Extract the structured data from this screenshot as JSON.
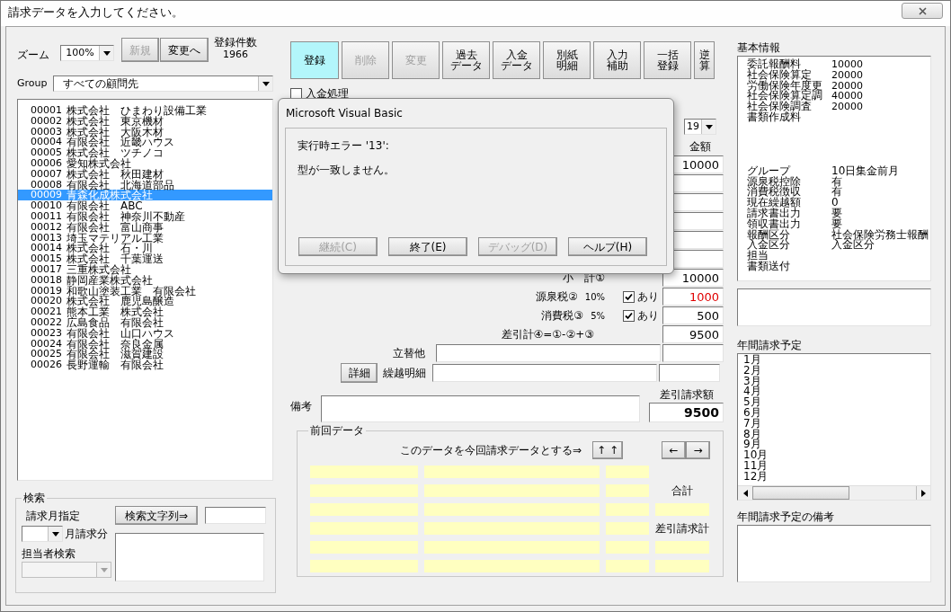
{
  "window": {
    "title": "請求データを入力してください。"
  },
  "zoom": {
    "label": "ズーム",
    "value": "100%"
  },
  "top_buttons": [
    {
      "label": "新規",
      "disabled": true
    },
    {
      "label": "変更へ",
      "disabled": false
    }
  ],
  "record_count": {
    "label": "登録件数",
    "value": "1966"
  },
  "group": {
    "label": "Group",
    "value": "すべての顧問先"
  },
  "clients": [
    {
      "code": "00001",
      "name": "株式会社　ひまわり設備工業",
      "selected": false
    },
    {
      "code": "00002",
      "name": "株式会社　東京機材",
      "selected": false
    },
    {
      "code": "00003",
      "name": "株式会社　大阪木材",
      "selected": false
    },
    {
      "code": "00004",
      "name": "有限会社　近畿ハウス",
      "selected": false
    },
    {
      "code": "00005",
      "name": "株式会社　ツチノコ",
      "selected": false
    },
    {
      "code": "00006",
      "name": "愛知株式会社",
      "selected": false
    },
    {
      "code": "00007",
      "name": "株式会社　秋田建材",
      "selected": false
    },
    {
      "code": "00008",
      "name": "有限会社　北海道部品",
      "selected": false
    },
    {
      "code": "00009",
      "name": "青森化成株式会社",
      "selected": true
    },
    {
      "code": "00010",
      "name": "有限会社　ABC",
      "selected": false
    },
    {
      "code": "00011",
      "name": "有限会社　神奈川不動産",
      "selected": false
    },
    {
      "code": "00012",
      "name": "有限会社　富山商事",
      "selected": false
    },
    {
      "code": "00013",
      "name": "埼玉マテリアル工業",
      "selected": false
    },
    {
      "code": "00014",
      "name": "株式会社　石・川",
      "selected": false
    },
    {
      "code": "00015",
      "name": "株式会社　千葉運送",
      "selected": false
    },
    {
      "code": "00017",
      "name": "三重株式会社",
      "selected": false
    },
    {
      "code": "00018",
      "name": "静岡産業株式会社",
      "selected": false
    },
    {
      "code": "00019",
      "name": "和歌山塗装工業　有限会社",
      "selected": false
    },
    {
      "code": "00020",
      "name": "株式会社　鹿児島醸造",
      "selected": false
    },
    {
      "code": "00021",
      "name": "熊本工業　株式会社",
      "selected": false
    },
    {
      "code": "00022",
      "name": "広島食品　有限会社",
      "selected": false
    },
    {
      "code": "00023",
      "name": "有限会社　山口ハウス",
      "selected": false
    },
    {
      "code": "00024",
      "name": "有限会社　奈良金属",
      "selected": false
    },
    {
      "code": "00025",
      "name": "有限会社　滋賀建設",
      "selected": false
    },
    {
      "code": "00026",
      "name": "長野運輸　有限会社",
      "selected": false
    }
  ],
  "search": {
    "title": "検索",
    "month_label": "請求月指定",
    "month_suffix": "月請求分",
    "staff_label": "担当者検索",
    "text_button": "検索文字列⇒"
  },
  "toolbar": [
    {
      "lines": [
        "登録"
      ],
      "highlighted": true,
      "disabled": false
    },
    {
      "lines": [
        "削除"
      ],
      "highlighted": false,
      "disabled": true
    },
    {
      "lines": [
        "変更"
      ],
      "highlighted": false,
      "disabled": true
    },
    {
      "lines": [
        "過去",
        "データ"
      ],
      "highlighted": false,
      "disabled": false
    },
    {
      "lines": [
        "入金",
        "データ"
      ],
      "highlighted": false,
      "disabled": false
    },
    {
      "lines": [
        "別紙",
        "明細"
      ],
      "highlighted": false,
      "disabled": false
    },
    {
      "lines": [
        "入力",
        "補助"
      ],
      "highlighted": false,
      "disabled": false
    },
    {
      "lines": [
        "一括",
        "登録"
      ],
      "highlighted": false,
      "disabled": false
    },
    {
      "lines": [
        "逆",
        "算"
      ],
      "highlighted": false,
      "disabled": false
    }
  ],
  "payment_processing": {
    "label": "入金処理",
    "checked": false
  },
  "period": {
    "value": "19"
  },
  "amounts": {
    "header": "金額",
    "first_value": "10000"
  },
  "totals": [
    {
      "label": "小　計①",
      "value": "10000",
      "negative": false
    },
    {
      "label": "源泉税②",
      "rate": "10%",
      "option": {
        "label": "あり",
        "checked": true
      },
      "value": "1000",
      "negative": true
    },
    {
      "label": "消費税③",
      "rate": "5%",
      "option": {
        "label": "あり",
        "checked": true
      },
      "value": "500",
      "negative": false
    },
    {
      "label": "差引計④=①-②+③",
      "value": "9500",
      "negative": false
    }
  ],
  "advances": {
    "label": "立替他"
  },
  "carryover": {
    "button": "詳細",
    "label": "繰越明細"
  },
  "remarks": {
    "label": "備考"
  },
  "net_billing": {
    "label": "差引請求額",
    "value": "9500"
  },
  "previous": {
    "title": "前回データ",
    "instruction": "このデータを今回請求データとする⇒",
    "copy_button": "↑ ↑",
    "prev_button": "←",
    "next_button": "→",
    "total_label": "合計",
    "net_label": "差引請求計"
  },
  "basic_info": {
    "title": "基本情報",
    "fees": [
      {
        "label": "委託報酬料",
        "value": "10000"
      },
      {
        "label": "社会保険算定",
        "value": "20000"
      },
      {
        "label": "労働保険年度更",
        "value": "20000"
      },
      {
        "label": "社会保険算定調",
        "value": "40000"
      },
      {
        "label": "社会保険調査",
        "value": "20000"
      },
      {
        "label": "書類作成料"
      }
    ],
    "details": [
      {
        "label": "グループ",
        "value": "10日集金前月"
      },
      {
        "label": "源泉税控除",
        "value": "有"
      },
      {
        "label": "消費税徴収",
        "value": "有"
      },
      {
        "label": "現在繰越額",
        "value": "0"
      },
      {
        "label": "請求書出力",
        "value": "要"
      },
      {
        "label": "領収書出力",
        "value": "要"
      },
      {
        "label": "報酬区分",
        "value": "社会保険労務士報酬"
      },
      {
        "label": "入金区分",
        "value": "入金区分"
      },
      {
        "label": "担当"
      },
      {
        "label": "書類送付"
      }
    ]
  },
  "annual_schedule": {
    "title": "年間請求予定",
    "months": [
      "1月",
      "2月",
      "3月",
      "4月",
      "5月",
      "6月",
      "7月",
      "8月",
      "9月",
      "10月",
      "11月",
      "12月"
    ]
  },
  "annual_remarks": {
    "title": "年間請求予定の備考"
  },
  "dialog": {
    "title": "Microsoft Visual Basic",
    "lines": [
      "実行時エラー '13':",
      "型が一致しません。"
    ],
    "buttons": [
      {
        "label": "継続(C)",
        "disabled": true
      },
      {
        "label": "終了(E)",
        "disabled": false
      },
      {
        "label": "デバッグ(D)",
        "disabled": true
      },
      {
        "label": "ヘルプ(H)",
        "disabled": false
      }
    ]
  }
}
